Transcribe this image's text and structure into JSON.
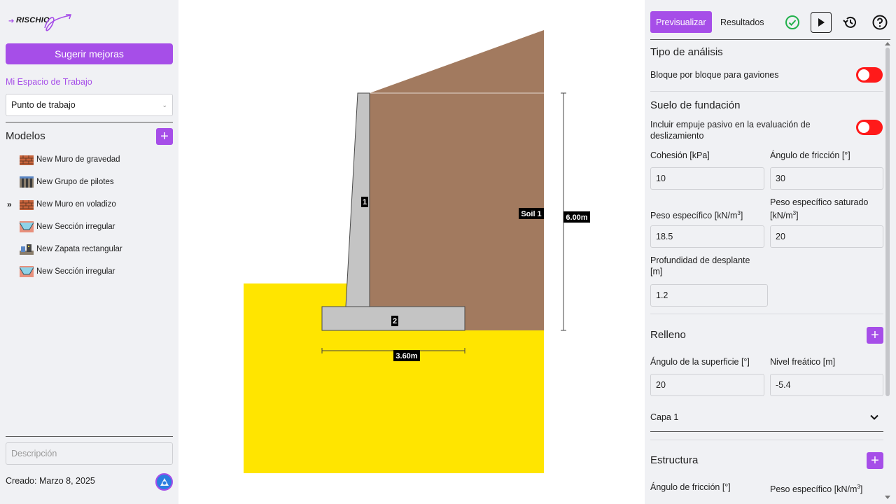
{
  "sidebar": {
    "logo_text": "RISCHIO",
    "suggest_label": "Sugerir mejoras",
    "workspace_label": "Mi Espacio de Trabajo",
    "workpoint_value": "Punto de trabajo",
    "models_title": "Modelos",
    "models": [
      {
        "label": "New Muro de gravedad",
        "icon": "brick-wall-icon",
        "active": false
      },
      {
        "label": "New Grupo de pilotes",
        "icon": "pile-group-icon",
        "active": false
      },
      {
        "label": "New Muro en voladizo",
        "icon": "brick-wall-icon",
        "active": true
      },
      {
        "label": "New Sección irregular",
        "icon": "irregular-section-icon",
        "active": false
      },
      {
        "label": "New Zapata rectangular",
        "icon": "footing-icon",
        "active": false
      },
      {
        "label": "New Sección irregular",
        "icon": "irregular-section-icon",
        "active": false
      }
    ],
    "active_marker": "»",
    "description_placeholder": "Descripción",
    "created_label": "Creado: Marzo 8, 2025"
  },
  "canvas": {
    "wall_label": "1",
    "footing_label": "2",
    "soil_label": "Soil 1",
    "height_dim": "6.00m",
    "width_dim": "3.60m",
    "colors": {
      "soil": "#a27a5f",
      "foundation": "#ffe500",
      "concrete": "#c4c4c4"
    }
  },
  "panel": {
    "tab_preview": "Previsualizar",
    "tab_results": "Resultados",
    "analysis_title": "Tipo de análisis",
    "gabion_label": "Bloque por bloque para gaviones",
    "foundation_title": "Suelo de fundación",
    "passive_label": "Incluir empuje pasivo en la evaluación de deslizamiento",
    "cohesion_label": "Cohesión [kPa]",
    "cohesion_value": "10",
    "friction_label": "Ángulo de fricción [°]",
    "friction_value": "30",
    "unit_weight_label": "Peso específico [kN/m",
    "unit_weight_value": "18.5",
    "sat_weight_label": "Peso específico saturado [kN/m",
    "sat_weight_value": "20",
    "depth_label": "Profundidad de desplante [m]",
    "depth_value": "1.2",
    "backfill_title": "Relleno",
    "surface_angle_label": "Ángulo de la superficie [°]",
    "surface_angle_value": "20",
    "water_level_label": "Nivel freático [m]",
    "water_level_value": "-5.4",
    "layer_label": "Capa 1",
    "structure_title": "Estructura",
    "struct_friction_label": "Ángulo de fricción [°]",
    "struct_weight_label": "Peso específico [kN/m",
    "superscript": "3",
    "label_suffix": "]",
    "colors": {
      "accent": "#a64ee8",
      "toggle_off": "#ff1a1a",
      "ok": "#22b14c"
    }
  }
}
